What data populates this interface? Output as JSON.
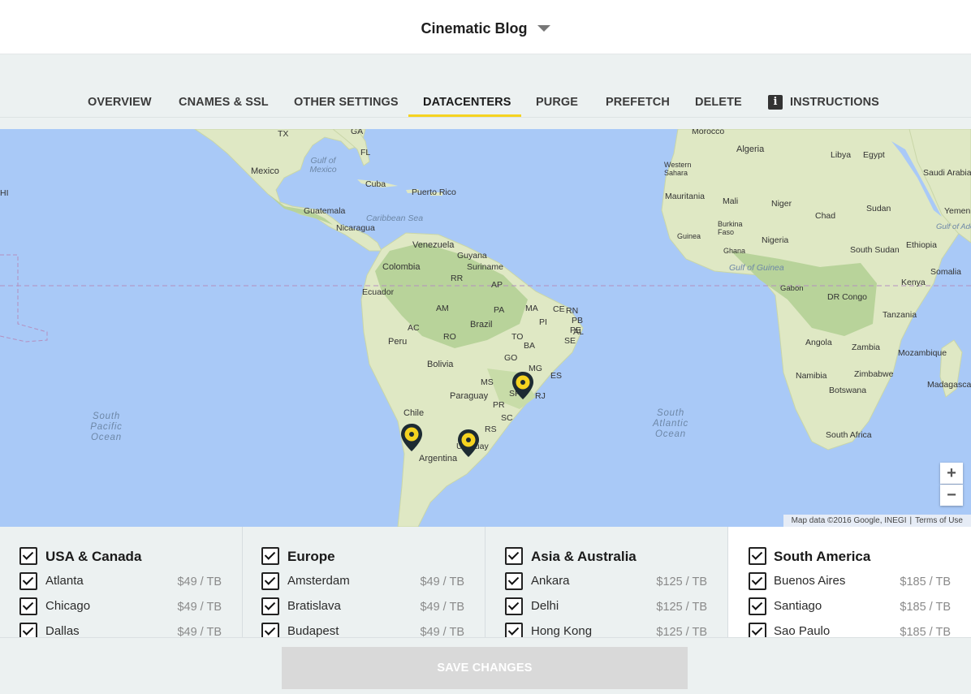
{
  "header": {
    "site_name": "Cinematic Blog",
    "dropdown_icon": "chevron-down-icon"
  },
  "tabs": [
    {
      "label": "OVERVIEW"
    },
    {
      "label": "CNAMES & SSL"
    },
    {
      "label": "OTHER SETTINGS"
    },
    {
      "label": "DATACENTERS",
      "active": true
    },
    {
      "label": "PURGE"
    },
    {
      "label": "PREFETCH"
    },
    {
      "label": "DELETE"
    },
    {
      "label": "INSTRUCTIONS",
      "icon": "info-icon"
    }
  ],
  "map": {
    "zoom_in": "+",
    "zoom_out": "−",
    "attribution": "Map data ©2016 Google, INEGI",
    "terms": "Terms of Use",
    "labels": [
      "TX",
      "GA",
      "FL",
      "Mexico",
      "Gulf of Mexico",
      "Cuba",
      "Puerto Rico",
      "HI",
      "Guatemala",
      "Caribbean Sea",
      "Nicaragua",
      "Venezuela",
      "Guyana",
      "Suriname",
      "Colombia",
      "RR",
      "AP",
      "Ecuador",
      "AM",
      "PA",
      "MA",
      "CE",
      "RN",
      "PB",
      "PE",
      "AL",
      "SE",
      "AC",
      "RO",
      "TO",
      "PI",
      "BA",
      "Peru",
      "Brazil",
      "GO",
      "MG",
      "ES",
      "Bolivia",
      "MS",
      "SP",
      "RJ",
      "Paraguay",
      "PR",
      "SC",
      "RS",
      "Chile",
      "Uruguay",
      "Argentina",
      "Morocco",
      "Algeria",
      "Libya",
      "Egypt",
      "Saudi Arabia",
      "Western Sahara",
      "Mauritania",
      "Mali",
      "Niger",
      "Sudan",
      "Yemen",
      "Chad",
      "Burkina Faso",
      "Guinea",
      "Ghana",
      "Nigeria",
      "South Sudan",
      "Ethiopia",
      "Gulf of Aden",
      "Gulf of Guinea",
      "Somalia",
      "Kenya",
      "Gabon",
      "DR Congo",
      "Tanzania",
      "Angola",
      "Zambia",
      "Mozambique",
      "Namibia",
      "Zimbabwe",
      "Madagascar",
      "Botswana",
      "South Africa"
    ],
    "oceans": [
      "South Pacific Ocean",
      "South Atlantic Ocean"
    ],
    "pins": [
      "Sao Paulo",
      "Santiago",
      "Buenos Aires"
    ],
    "colors": {
      "water": "#a9c9f7",
      "land": "#dfe8c4",
      "forest": "#b8d39a",
      "pin": "#f5d320",
      "pin_outline": "#1d2b33"
    }
  },
  "regions": [
    {
      "title": "USA & Canada",
      "checked": true,
      "cities": [
        {
          "name": "Atlanta",
          "price": "$49 / TB",
          "checked": true
        },
        {
          "name": "Chicago",
          "price": "$49 / TB",
          "checked": true
        },
        {
          "name": "Dallas",
          "price": "$49 / TB",
          "checked": true
        }
      ]
    },
    {
      "title": "Europe",
      "checked": true,
      "cities": [
        {
          "name": "Amsterdam",
          "price": "$49 / TB",
          "checked": true
        },
        {
          "name": "Bratislava",
          "price": "$49 / TB",
          "checked": true
        },
        {
          "name": "Budapest",
          "price": "$49 / TB",
          "checked": true
        }
      ]
    },
    {
      "title": "Asia & Australia",
      "checked": true,
      "cities": [
        {
          "name": "Ankara",
          "price": "$125 / TB",
          "checked": true
        },
        {
          "name": "Delhi",
          "price": "$125 / TB",
          "checked": true
        },
        {
          "name": "Hong Kong",
          "price": "$125 / TB",
          "checked": true
        }
      ]
    },
    {
      "title": "South America",
      "checked": true,
      "cities": [
        {
          "name": "Buenos Aires",
          "price": "$185 / TB",
          "checked": true
        },
        {
          "name": "Santiago",
          "price": "$185 / TB",
          "checked": true
        },
        {
          "name": "Sao Paulo",
          "price": "$185 / TB",
          "checked": true
        }
      ]
    }
  ],
  "footer": {
    "save_label": "SAVE CHANGES",
    "enabled": false
  }
}
